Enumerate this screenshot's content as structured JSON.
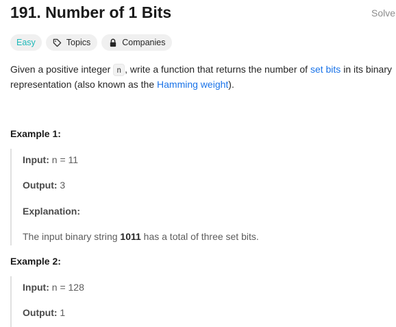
{
  "problem": {
    "title": "191. Number of 1 Bits",
    "status": "Solve"
  },
  "tags": {
    "difficulty": "Easy",
    "topics": "Topics",
    "companies": "Companies"
  },
  "description": {
    "part1": "Given a positive integer ",
    "code_n": "n",
    "part2": ", write a function that returns the number of ",
    "link_set_bits": "set bits",
    "part3": " in its binary representation (also known as the ",
    "link_hamming": "Hamming weight",
    "part4": ")."
  },
  "examples": [
    {
      "heading": "Example 1:",
      "input_label": "Input:",
      "input_value": "n = 11",
      "output_label": "Output:",
      "output_value": "3",
      "explanation_label": "Explanation:",
      "explanation_part1": "The input binary string ",
      "explanation_bold": "1011",
      "explanation_part2": " has a total of three set bits."
    },
    {
      "heading": "Example 2:",
      "input_label": "Input:",
      "input_value": "n = 128",
      "output_label": "Output:",
      "output_value": "1"
    }
  ],
  "colors": {
    "easy": "#1cb8b8",
    "link": "#1a73e8",
    "tag_bg": "#f0f0f0"
  }
}
